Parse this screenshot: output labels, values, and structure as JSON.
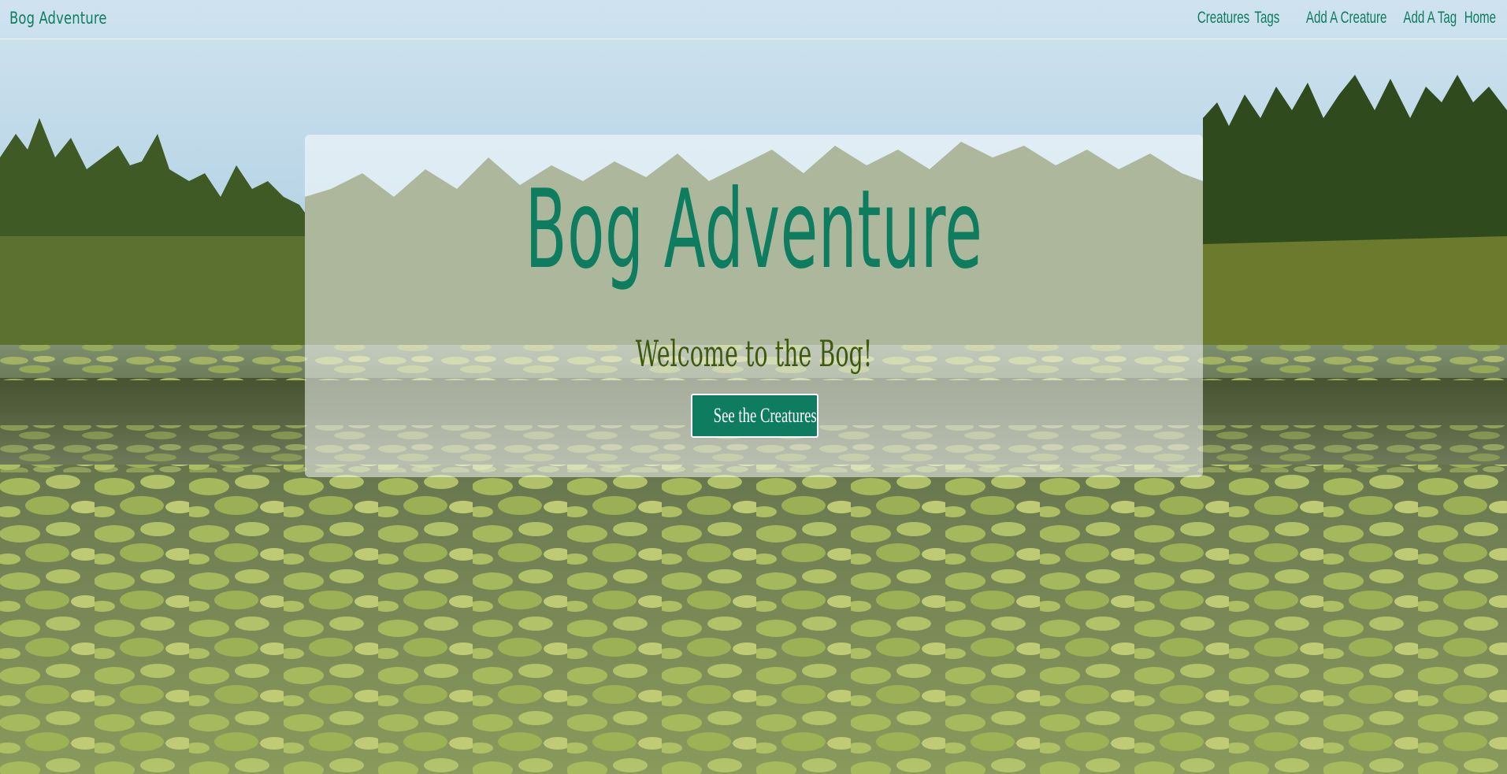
{
  "navbar": {
    "brand": "Bog Adventure",
    "links": [
      "Creatures",
      "Tags",
      "Add A Creature",
      "Add A Tag",
      "Home"
    ]
  },
  "hero": {
    "title": "Bog Adventure",
    "subtitle": "Welcome to the Bog!",
    "button_label": "See the Creatures!"
  },
  "colors": {
    "brand_green": "#0e7c5e",
    "subtitle_olive": "#3d5a0c",
    "button_bg": "#0e7c5e",
    "button_text": "#ffffff"
  },
  "background": {
    "image_subject": "bog-with-lily-pads-and-trees"
  }
}
